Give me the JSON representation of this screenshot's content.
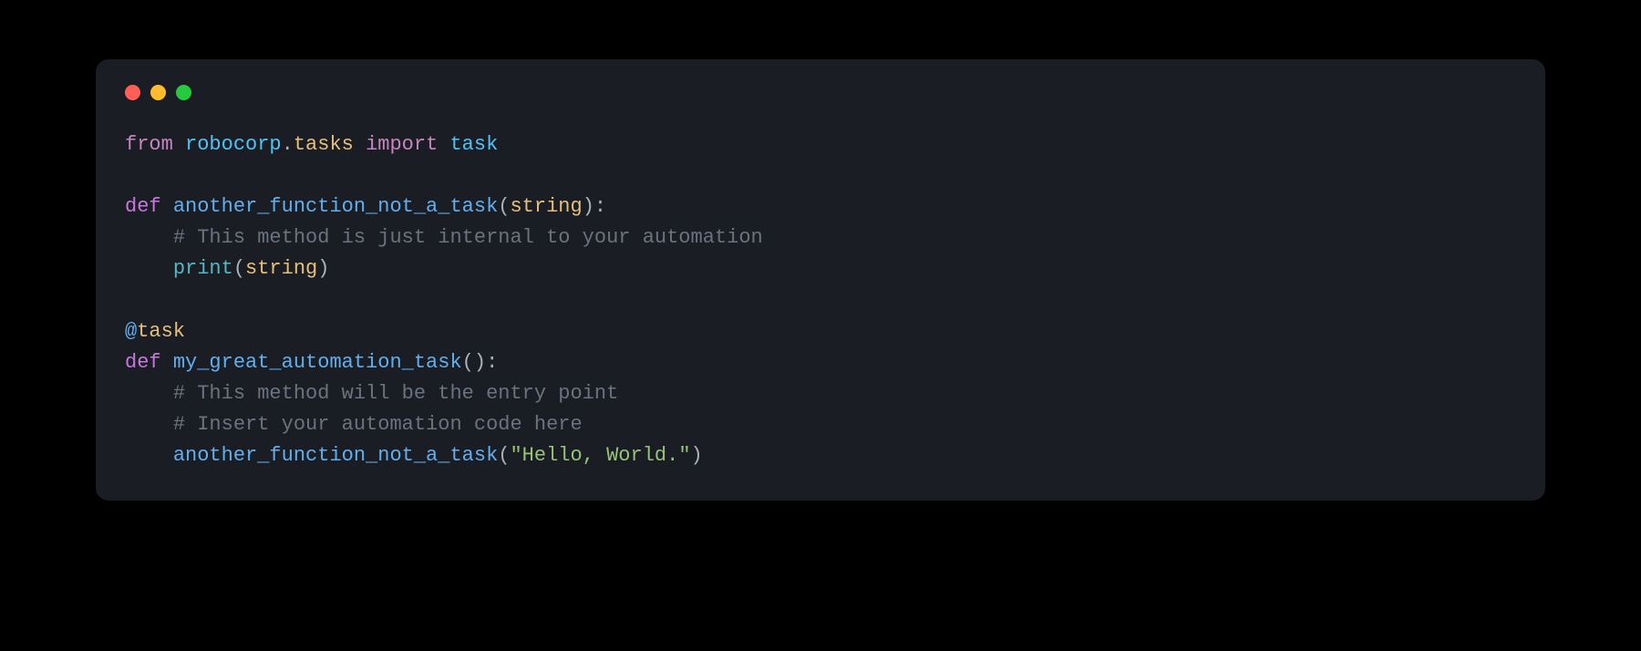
{
  "code": {
    "line1": {
      "from": "from",
      "module": "robocorp",
      "dot": ".",
      "attr": "tasks",
      "import": "import",
      "name": "task"
    },
    "line3": {
      "def": "def",
      "fn": "another_function_not_a_task",
      "open": "(",
      "param": "string",
      "close": "):"
    },
    "line4": {
      "indent": "    ",
      "comment": "# This method is just internal to your automation"
    },
    "line5": {
      "indent": "    ",
      "builtin": "print",
      "open": "(",
      "arg": "string",
      "close": ")"
    },
    "line7": {
      "at": "@",
      "dec": "task"
    },
    "line8": {
      "def": "def",
      "fn": "my_great_automation_task",
      "parens": "():"
    },
    "line9": {
      "indent": "    ",
      "comment": "# This method will be the entry point"
    },
    "line10": {
      "indent": "    ",
      "comment": "# Insert your automation code here"
    },
    "line11": {
      "indent": "    ",
      "call": "another_function_not_a_task",
      "open": "(",
      "str": "\"Hello, World.\"",
      "close": ")"
    }
  }
}
